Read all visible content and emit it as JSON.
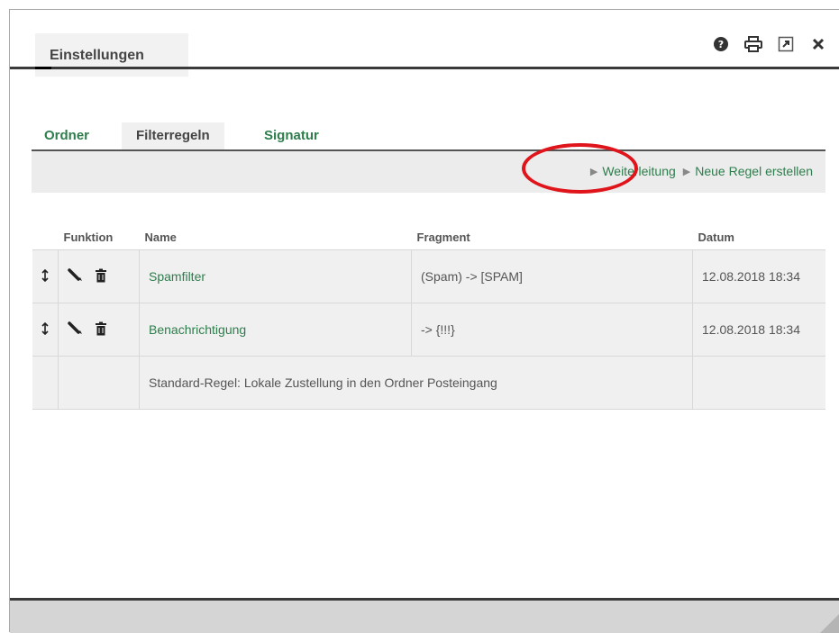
{
  "window": {
    "title": "Einstellungen",
    "icons": [
      "help-icon",
      "print-icon",
      "popout-icon",
      "close-icon"
    ]
  },
  "subtabs": [
    {
      "label": "Ordner",
      "active": false
    },
    {
      "label": "Filterregeln",
      "active": true
    },
    {
      "label": "Signatur",
      "active": false
    }
  ],
  "actions": {
    "forward": "Weiterleitung",
    "new_rule": "Neue Regel erstellen"
  },
  "table": {
    "columns": [
      "Funktion",
      "Name",
      "Fragment",
      "Datum"
    ],
    "rows": [
      {
        "name": "Spamfilter",
        "fragment": "(Spam) -> [SPAM]",
        "date": "12.08.2018 18:34"
      },
      {
        "name": "Benachrichtigung",
        "fragment": "-> {!!!}",
        "date": "12.08.2018 18:34"
      }
    ],
    "default_rule": "Standard-Regel: Lokale Zustellung in den Ordner Posteingang"
  },
  "colors": {
    "accent_green": "#2e7d4c",
    "highlight_red": "#e0141b",
    "bar_gray": "#ececec"
  }
}
